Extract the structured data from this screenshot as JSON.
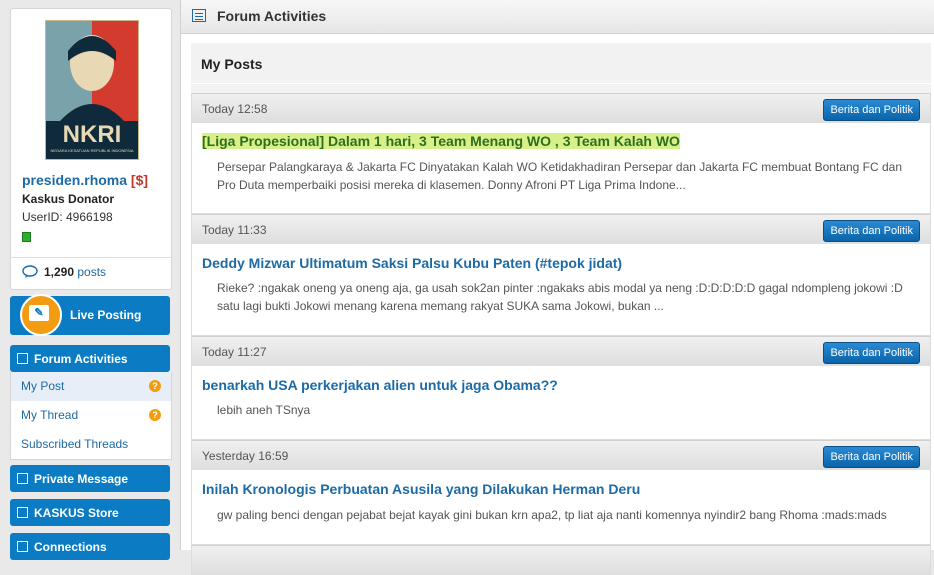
{
  "profile": {
    "username": "presiden.rhoma",
    "donator_tag": "[$]",
    "rank": "Kaskus Donator",
    "userid_label": "UserID: 4966198",
    "post_count": "1,290",
    "post_label": "posts",
    "avatar_text": "NKRI",
    "avatar_sub": "NEGARA KESATUAN REPUBLIK INDONESIA"
  },
  "sidebar": {
    "live_posting": "Live Posting",
    "forum_activities": "Forum Activities",
    "submenu": [
      {
        "label": "My Post",
        "badge": "?"
      },
      {
        "label": "My Thread",
        "badge": "?"
      },
      {
        "label": "Subscribed Threads",
        "badge": ""
      }
    ],
    "private_message": "Private Message",
    "kaskus_store": "KASKUS Store",
    "connections": "Connections"
  },
  "main": {
    "header_title": "Forum Activities",
    "section_title": "My Posts",
    "posts": [
      {
        "time": "Today 12:58",
        "category": "Berita dan Politik",
        "title": "[Liga Propesional] Dalam 1 hari, 3 Team Menang WO , 3 Team Kalah WO",
        "body": "Persepar Palangkaraya & Jakarta FC Dinyatakan Kalah WO Ketidakhadiran Persepar dan Jakarta FC membuat Bontang FC dan Pro Duta memperbaiki posisi mereka di klasemen. Donny Afroni PT Liga Prima Indone..."
      },
      {
        "time": "Today 11:33",
        "category": "Berita dan Politik",
        "title": "Deddy Mizwar Ultimatum Saksi Palsu Kubu Paten (#tepok jidat)",
        "body": "Rieke? :ngakak oneng ya oneng aja, ga usah sok2an pinter :ngakaks abis modal ya neng :D:D:D:D:D gagal ndompleng jokowi :D satu lagi bukti Jokowi menang karena memang rakyat SUKA sama Jokowi, bukan ..."
      },
      {
        "time": "Today 11:27",
        "category": "Berita dan Politik",
        "title": "benarkah USA perkerjakan alien untuk jaga Obama??",
        "body": "lebih aneh TSnya"
      },
      {
        "time": "Yesterday 16:59",
        "category": "Berita dan Politik",
        "title": "Inilah Kronologis Perbuatan Asusila yang Dilakukan Herman Deru",
        "body": "gw paling benci dengan pejabat bejat kayak gini bukan krn apa2, tp liat aja nanti komennya nyindir2 bang Rhoma :mads:mads"
      }
    ]
  }
}
